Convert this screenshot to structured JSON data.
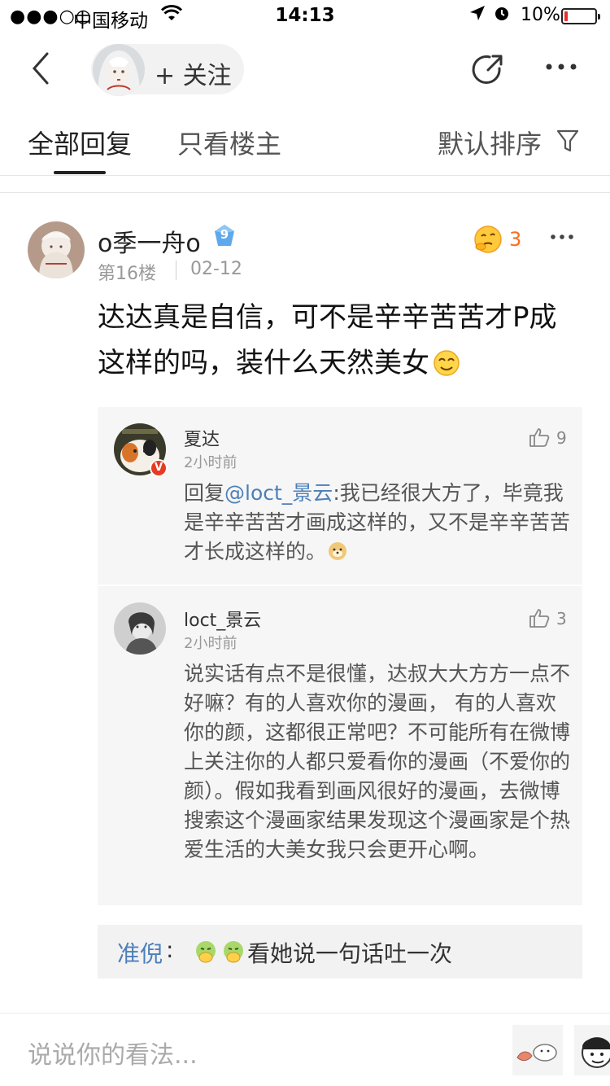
{
  "status_bar": {
    "signal": "●●●○○",
    "carrier": "中国移动",
    "time": "14:13",
    "battery_text": "10%",
    "battery_level": 0.1,
    "battery_color": "#e5302a"
  },
  "nav": {
    "follow_label": "+ 关注"
  },
  "tabs": {
    "all_replies": "全部回复",
    "author_only": "只看楼主",
    "sort_label": "默认排序"
  },
  "comment": {
    "username": "o季一舟o",
    "vip_level": "9",
    "floor": "第16楼",
    "date": "02-12",
    "likes": "3",
    "text": "达达真是自信，可不是辛辛苦苦才P成这样的吗，装什么天然美女"
  },
  "replies": [
    {
      "username": "夏达",
      "time": "2小时前",
      "likes": "9",
      "verified_badge": "V",
      "prefix": "回复",
      "mention": "@loct_景云",
      "text": ":我已经很大方了，毕竟我是辛辛苦苦才画成这样的，又不是辛辛苦苦才长成这样的。"
    },
    {
      "username": "loct_景云",
      "time": "2小时前",
      "likes": "3",
      "text": "说实话有点不是很懂，达叔大大方方一点不好嘛？有的人喜欢你的漫画， 有的人喜欢你的颜，这都很正常吧？不可能所有在微博上关注你的人都只爱看你的漫画（不爱你的颜）。假如我看到画风很好的漫画，去微博搜索这个漫画家结果发现这个漫画家是个热爱生活的大美女我只会更开心啊。"
    }
  ],
  "extra_reply": {
    "username": "准倪",
    "colon": ":",
    "text": "看她说一句话吐一次"
  },
  "input": {
    "placeholder": "说说你的看法..."
  },
  "colors": {
    "accent_link": "#4d7fb8",
    "like_orange": "#ff6a1a"
  }
}
